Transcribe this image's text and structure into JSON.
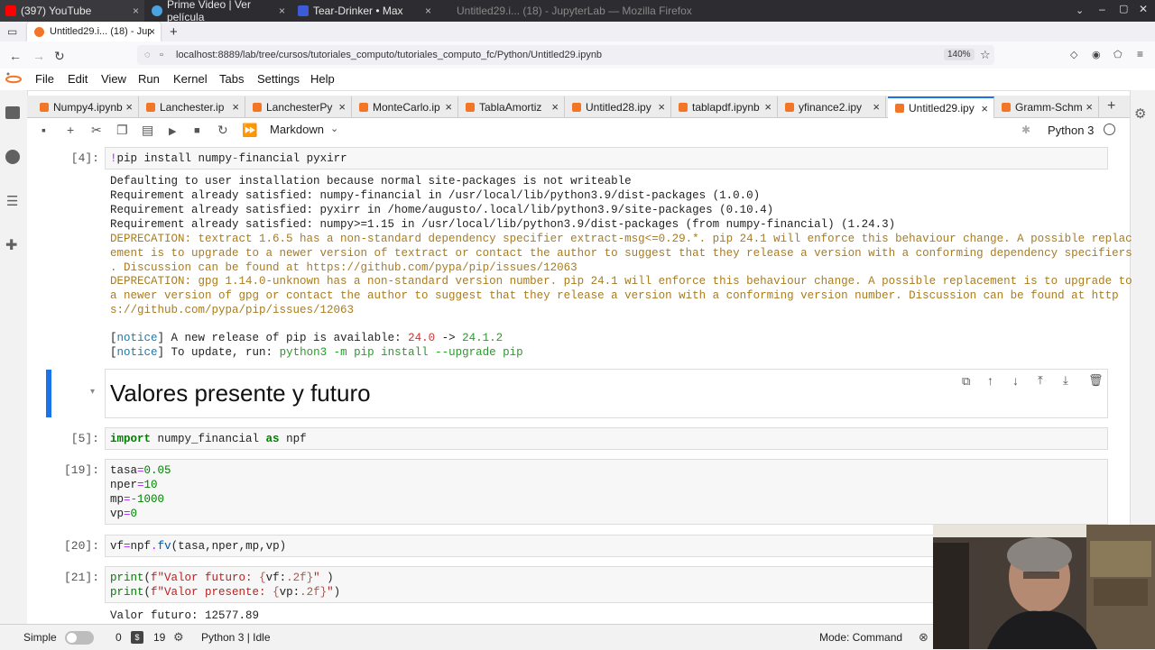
{
  "os_tabs": [
    {
      "label": "(397) YouTube",
      "close": "×"
    },
    {
      "label": "Prime Video | Ver película",
      "close": "×"
    },
    {
      "label": "Tear-Drinker • Max",
      "close": "×"
    },
    {
      "label": "Untitled29.i... (18) - JupyterLab — Mozilla Firefox",
      "close": ""
    }
  ],
  "browser": {
    "tab_label": "Untitled29.i... (18) - Jupyt",
    "tab_close": "×",
    "new_tab": "+",
    "url": "localhost:8889/lab/tree/cursos/tutoriales_computo/tutoriales_computo_fc/Python/Untitled29.ipynb",
    "zoom": "140%"
  },
  "menu": [
    "File",
    "Edit",
    "View",
    "Run",
    "Kernel",
    "Tabs",
    "Settings",
    "Help"
  ],
  "notebook_tabs": [
    {
      "label": "Numpy4.ipynb",
      "close": "×"
    },
    {
      "label": "Lanchester.ip",
      "close": "×"
    },
    {
      "label": "LanchesterPy",
      "close": "×"
    },
    {
      "label": "MonteCarlo.ip",
      "close": "×"
    },
    {
      "label": "TablaAmortiz",
      "close": "×"
    },
    {
      "label": "Untitled28.ipy",
      "close": "×"
    },
    {
      "label": "tablapdf.ipynb",
      "close": "×"
    },
    {
      "label": "yfinance2.ipy",
      "close": "×"
    },
    {
      "label": "Untitled29.ipy",
      "close": "×"
    },
    {
      "label": "Gramm-Schm",
      "close": "×"
    }
  ],
  "toolbar": {
    "cell_type": "Markdown",
    "kernel": "Python 3"
  },
  "cells": {
    "c4": {
      "prompt": "[4]:",
      "code_bang": "!",
      "code_rest": "pip install numpy",
      "code_dash": "-",
      "code_tail": "financial pyxirr",
      "out": [
        "Defaulting to user installation because normal site-packages is not writeable",
        "Requirement already satisfied: numpy-financial in /usr/local/lib/python3.9/dist-packages (1.0.0)",
        "Requirement already satisfied: pyxirr in /home/augusto/.local/lib/python3.9/site-packages (0.10.4)",
        "Requirement already satisfied: numpy>=1.15 in /usr/local/lib/python3.9/dist-packages (from numpy-financial) (1.24.3)"
      ],
      "warn": [
        "DEPRECATION: textract 1.6.5 has a non-standard dependency specifier extract-msg<=0.29.*. pip 24.1 will enforce this behaviour change. A possible replac",
        "ement is to upgrade to a newer version of textract or contact the author to suggest that they release a version with a conforming dependency specifiers",
        ". Discussion can be found at https://github.com/pypa/pip/issues/12063",
        "DEPRECATION: gpg 1.14.0-unknown has a non-standard version number. pip 24.1 will enforce this behaviour change. A possible replacement is to upgrade to",
        "a newer version of gpg or contact the author to suggest that they release a version with a conforming version number. Discussion can be found at http",
        "s://github.com/pypa/pip/issues/12063"
      ],
      "notice1_a": "[",
      "notice1_b": "notice",
      "notice1_c": "] A new release of pip is available: ",
      "notice1_old": "24.0",
      "notice1_arrow": " -> ",
      "notice1_new": "24.1.2",
      "notice2_a": "[",
      "notice2_b": "notice",
      "notice2_c": "] To update, run: ",
      "notice2_cmd": "python3 -m pip install --upgrade pip"
    },
    "md": {
      "heading": "Valores presente y futuro"
    },
    "c5": {
      "prompt": "[5]:",
      "kw1": "import",
      "mod": " numpy_financial ",
      "kw2": "as",
      "alias": " npf"
    },
    "c19": {
      "prompt": "[19]:",
      "l1a": "tasa",
      "l1b": "=",
      "l1c": "0.05",
      "l2a": "nper",
      "l2b": "=",
      "l2c": "10",
      "l3a": "mp",
      "l3b": "=-",
      "l3c": "1000",
      "l4a": "vp",
      "l4b": "=",
      "l4c": "0"
    },
    "c20": {
      "prompt": "[20]:",
      "a": "vf",
      "b": "=",
      "c": "npf",
      "d": ".",
      "e": "fv",
      "f": "(tasa,nper,mp,vp)"
    },
    "c21": {
      "prompt": "[21]:",
      "p1": "print",
      "p1b": "(",
      "p1c": "f\"Valor futuro: ",
      "p1d": "{",
      "p1e": "vf:",
      "p1f": ".2f",
      "p1g": "}",
      "p1h": "\"",
      "p1i": " )",
      "p2": "print",
      "p2b": "(",
      "p2c": "f\"Valor presente: ",
      "p2d": "{",
      "p2e": "vp:",
      "p2f": ".2f",
      "p2g": "}",
      "p2h": "\"",
      "p2i": ")",
      "out": "Valor futuro: 12577.89"
    }
  },
  "status": {
    "mode_label": "Simple",
    "c1": "0",
    "c2": "19",
    "kernel": "Python 3 | Idle",
    "mode": "Mode: Command"
  },
  "colors": {
    "accent": "#1a73e8",
    "jupyter_orange": "#f37626"
  }
}
